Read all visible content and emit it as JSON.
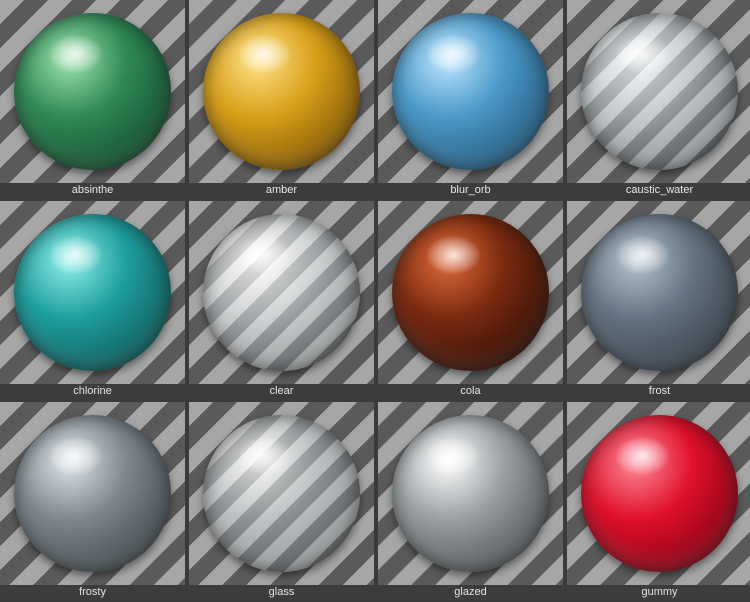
{
  "materials": [
    {
      "label": "absinthe",
      "icon": "absinthe-material-sphere-icon",
      "base": "#2e8a55",
      "dark": "#0f3d24",
      "light": "#9fe3b0"
    },
    {
      "label": "amber",
      "icon": "amber-material-sphere-icon",
      "base": "#d9a019",
      "dark": "#6b4300",
      "light": "#ffe38a"
    },
    {
      "label": "blur_orb",
      "icon": "blur-orb-material-sphere-icon",
      "base": "#4a9ac9",
      "dark": "#1b4868",
      "light": "#bfe6ff"
    },
    {
      "label": "caustic_water",
      "icon": "caustic-water-material-sphere-icon",
      "base": "#a9b0b4",
      "dark": "#3e4447",
      "light": "#f2f6f8"
    },
    {
      "label": "chlorine",
      "icon": "chlorine-material-sphere-icon",
      "base": "#1f9f9f",
      "dark": "#0a4747",
      "light": "#8ff0ea"
    },
    {
      "label": "clear",
      "icon": "clear-material-sphere-icon",
      "base": "#b7bbbd",
      "dark": "#4a4e50",
      "light": "#ffffff"
    },
    {
      "label": "cola",
      "icon": "cola-material-sphere-icon",
      "base": "#7a2a0f",
      "dark": "#1e0805",
      "light": "#e06a3a"
    },
    {
      "label": "frost",
      "icon": "frost-material-sphere-icon",
      "base": "#657482",
      "dark": "#2c343b",
      "light": "#b5c3cf"
    },
    {
      "label": "frosty",
      "icon": "frosty-material-sphere-icon",
      "base": "#7f888e",
      "dark": "#33393d",
      "light": "#dfe6ea"
    },
    {
      "label": "glass",
      "icon": "glass-material-sphere-icon",
      "base": "#9fa4a6",
      "dark": "#4c5052",
      "light": "#f4f4f4"
    },
    {
      "label": "glazed",
      "icon": "glazed-material-sphere-icon",
      "base": "#9aa0a3",
      "dark": "#3e4244",
      "light": "#ffffff"
    },
    {
      "label": "gummy",
      "icon": "gummy-material-sphere-icon",
      "base": "#e0102a",
      "dark": "#6a0010",
      "light": "#ff8a9a"
    }
  ]
}
